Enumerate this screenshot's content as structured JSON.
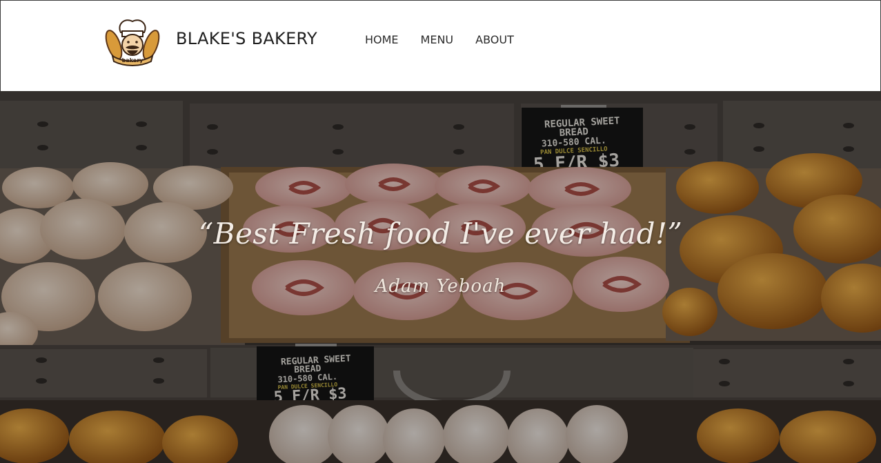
{
  "header": {
    "brand": "BLAKE'S BAKERY",
    "logo_text": "bakery",
    "nav": [
      "HOME",
      "MENU",
      "ABOUT"
    ]
  },
  "hero": {
    "quote": "“Best Fresh food I've ever had!”",
    "author": "Adam Yeboah",
    "sign_top": {
      "line1": "REGULAR SWEET",
      "line2": "BREAD",
      "line3": "310-580 CAL.",
      "line4": "PAN DULCE SENCILLO",
      "price": "5 F/R $3"
    },
    "sign_bottom": {
      "line1": "REGULAR SWEET",
      "line2": "BREAD",
      "line3": "310-580 CAL.",
      "line4": "PAN DULCE SENCILLO",
      "price": "5 F/R $3"
    }
  }
}
